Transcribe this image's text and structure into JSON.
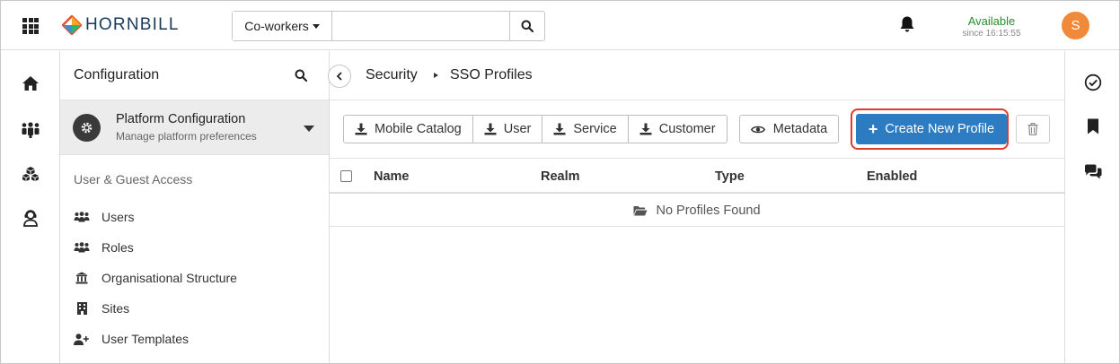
{
  "header": {
    "logo_text": "HORNBILL",
    "search_scope": "Co-workers",
    "search_value": "",
    "status": "Available",
    "status_since": "since 16:15:55",
    "avatar_initial": "S"
  },
  "sidebar": {
    "title": "Configuration",
    "current_section": {
      "title": "Platform Configuration",
      "subtitle": "Manage platform preferences"
    },
    "section_header": "User & Guest Access",
    "items": [
      {
        "label": "Users",
        "icon": "users-icon"
      },
      {
        "label": "Roles",
        "icon": "roles-icon"
      },
      {
        "label": "Organisational Structure",
        "icon": "bank-icon"
      },
      {
        "label": "Sites",
        "icon": "building-icon"
      },
      {
        "label": "User Templates",
        "icon": "user-plus-icon"
      }
    ]
  },
  "breadcrumb": {
    "parent": "Security",
    "current": "SSO Profiles"
  },
  "toolbar": {
    "download_buttons": [
      "Mobile Catalog",
      "User",
      "Service",
      "Customer"
    ],
    "metadata_label": "Metadata",
    "create_label": "Create New Profile"
  },
  "table": {
    "columns": [
      "Name",
      "Realm",
      "Type",
      "Enabled"
    ],
    "empty_message": "No Profiles Found"
  },
  "colors": {
    "primary": "#2d7bc0",
    "highlight": "#e23b2e",
    "status_green": "#2e8b2e",
    "avatar": "#f08a3a"
  }
}
